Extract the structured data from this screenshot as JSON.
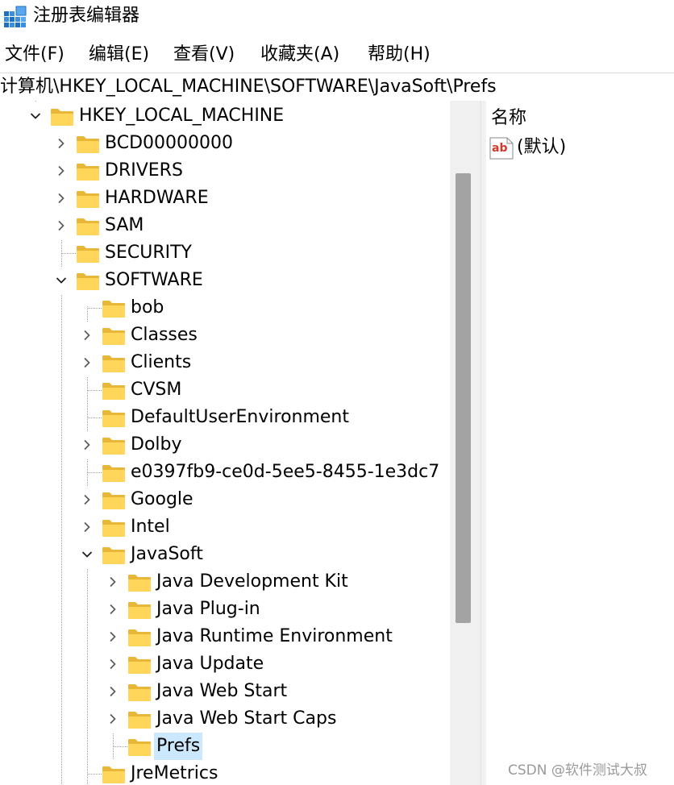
{
  "window": {
    "title": "注册表编辑器"
  },
  "menu": [
    {
      "label": "文件(F)",
      "name": "menu-file"
    },
    {
      "label": "编辑(E)",
      "name": "menu-edit"
    },
    {
      "label": "查看(V)",
      "name": "menu-view"
    },
    {
      "label": "收藏夹(A)",
      "name": "menu-favorites"
    },
    {
      "label": "帮助(H)",
      "name": "menu-help"
    }
  ],
  "address": {
    "path": "计算机\\HKEY_LOCAL_MACHINE\\SOFTWARE\\JavaSoft\\Prefs"
  },
  "tree": {
    "root": {
      "label": "HKEY_LOCAL_MACHINE",
      "expanded": true
    },
    "level1": [
      {
        "label": "BCD00000000",
        "expander": "collapsed"
      },
      {
        "label": "DRIVERS",
        "expander": "collapsed"
      },
      {
        "label": "HARDWARE",
        "expander": "collapsed"
      },
      {
        "label": "SAM",
        "expander": "collapsed"
      },
      {
        "label": "SECURITY",
        "expander": "none"
      },
      {
        "label": "SOFTWARE",
        "expander": "expanded"
      }
    ],
    "software_children": [
      {
        "label": "bob",
        "expander": "none"
      },
      {
        "label": "Classes",
        "expander": "collapsed"
      },
      {
        "label": "Clients",
        "expander": "collapsed"
      },
      {
        "label": "CVSM",
        "expander": "none"
      },
      {
        "label": "DefaultUserEnvironment",
        "expander": "none"
      },
      {
        "label": "Dolby",
        "expander": "collapsed"
      },
      {
        "label": "e0397fb9-ce0d-5ee5-8455-1e3dc7",
        "expander": "none"
      },
      {
        "label": "Google",
        "expander": "collapsed"
      },
      {
        "label": "Intel",
        "expander": "collapsed"
      },
      {
        "label": "JavaSoft",
        "expander": "expanded"
      }
    ],
    "javasoft_children": [
      {
        "label": "Java Development Kit",
        "expander": "collapsed"
      },
      {
        "label": "Java Plug-in",
        "expander": "collapsed"
      },
      {
        "label": "Java Runtime Environment",
        "expander": "collapsed"
      },
      {
        "label": "Java Update",
        "expander": "collapsed"
      },
      {
        "label": "Java Web Start",
        "expander": "collapsed"
      },
      {
        "label": "Java Web Start Caps",
        "expander": "collapsed"
      },
      {
        "label": "Prefs",
        "expander": "none",
        "selected": true
      }
    ],
    "after_javasoft": [
      {
        "label": "JreMetrics",
        "expander": "none"
      }
    ]
  },
  "values": {
    "column_name": "名称",
    "rows": [
      {
        "icon": "string-value-icon",
        "icon_text": "ab",
        "name": "(默认)"
      }
    ]
  },
  "watermark": "CSDN @软件测试大叔",
  "colors": {
    "selection": "#cce8ff",
    "folder": "#ffd65a",
    "scroll_thumb": "#a3a3a3",
    "string_icon_red": "#d33a2c"
  }
}
